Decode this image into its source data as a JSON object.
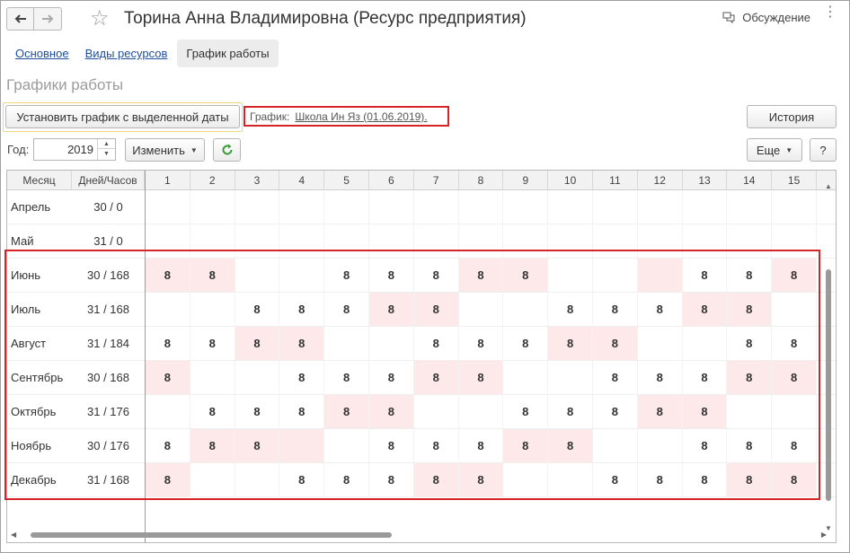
{
  "window": {
    "title": "Торина Анна Владимировна (Ресурс предприятия)",
    "discussion_label": "Обсуждение"
  },
  "tabs": [
    {
      "label": "Основное"
    },
    {
      "label": "Виды ресурсов"
    },
    {
      "label": "График работы",
      "active": true
    }
  ],
  "section_title": "Графики работы",
  "toolbar": {
    "set_schedule_label": "Установить график с выделенной даты",
    "schedule_label": "График:",
    "schedule_value": "Школа Ин Яз (01.06.2019).",
    "history_label": "История",
    "year_label": "Год:",
    "year_value": "2019",
    "change_label": "Изменить",
    "more_label": "Еще",
    "help_label": "?"
  },
  "table": {
    "col_month": "Месяц",
    "col_days_hours": "Дней/Часов",
    "day_columns": [
      "1",
      "2",
      "3",
      "4",
      "5",
      "6",
      "7",
      "8",
      "9",
      "10",
      "11",
      "12",
      "13",
      "14",
      "15"
    ],
    "rows": [
      {
        "month": "Апрель",
        "days_hours": "30 / 0",
        "cells": [
          "",
          "",
          "",
          "",
          "",
          "",
          "",
          "",
          "",
          "",
          "",
          "",
          "",
          "",
          ""
        ],
        "highlight": []
      },
      {
        "month": "Май",
        "days_hours": "31 / 0",
        "cells": [
          "",
          "",
          "",
          "",
          "",
          "",
          "",
          "",
          "",
          "",
          "",
          "",
          "",
          "",
          ""
        ],
        "highlight": []
      },
      {
        "month": "Июнь",
        "days_hours": "30 / 168",
        "cells": [
          "8",
          "8",
          "",
          "",
          "8",
          "8",
          "8",
          "8",
          "8",
          "",
          "",
          "",
          "8",
          "8",
          "8"
        ],
        "highlight": [
          1,
          2,
          8,
          9,
          12,
          15
        ]
      },
      {
        "month": "Июль",
        "days_hours": "31 / 168",
        "cells": [
          "",
          "",
          "8",
          "8",
          "8",
          "8",
          "8",
          "",
          "",
          "8",
          "8",
          "8",
          "8",
          "8",
          ""
        ],
        "highlight": [
          6,
          7,
          13,
          14
        ]
      },
      {
        "month": "Август",
        "days_hours": "31 / 184",
        "cells": [
          "8",
          "8",
          "8",
          "8",
          "",
          "",
          "8",
          "8",
          "8",
          "8",
          "8",
          "",
          "",
          "8",
          "8"
        ],
        "highlight": [
          3,
          4,
          10,
          11
        ]
      },
      {
        "month": "Сентябрь",
        "days_hours": "30 / 168",
        "cells": [
          "8",
          "",
          "",
          "8",
          "8",
          "8",
          "8",
          "8",
          "",
          "",
          "8",
          "8",
          "8",
          "8",
          "8"
        ],
        "highlight": [
          1,
          7,
          8,
          14,
          15
        ]
      },
      {
        "month": "Октябрь",
        "days_hours": "31 / 176",
        "cells": [
          "",
          "8",
          "8",
          "8",
          "8",
          "8",
          "",
          "",
          "8",
          "8",
          "8",
          "8",
          "8",
          "",
          ""
        ],
        "highlight": [
          5,
          6,
          12,
          13
        ]
      },
      {
        "month": "Ноябрь",
        "days_hours": "30 / 176",
        "cells": [
          "8",
          "8",
          "8",
          "",
          "",
          "8",
          "8",
          "8",
          "8",
          "8",
          "",
          "",
          "8",
          "8",
          "8"
        ],
        "highlight": [
          2,
          3,
          4,
          9,
          10
        ]
      },
      {
        "month": "Декабрь",
        "days_hours": "31 / 168",
        "cells": [
          "8",
          "",
          "",
          "8",
          "8",
          "8",
          "8",
          "8",
          "",
          "",
          "8",
          "8",
          "8",
          "8",
          "8"
        ],
        "highlight": [
          1,
          7,
          8,
          14,
          15
        ]
      }
    ]
  },
  "colors": {
    "highlight": "#fde9e9",
    "annotation_red": "#d6232a",
    "link_blue": "#1e4e9c",
    "refresh_green": "#3a9a3a"
  }
}
